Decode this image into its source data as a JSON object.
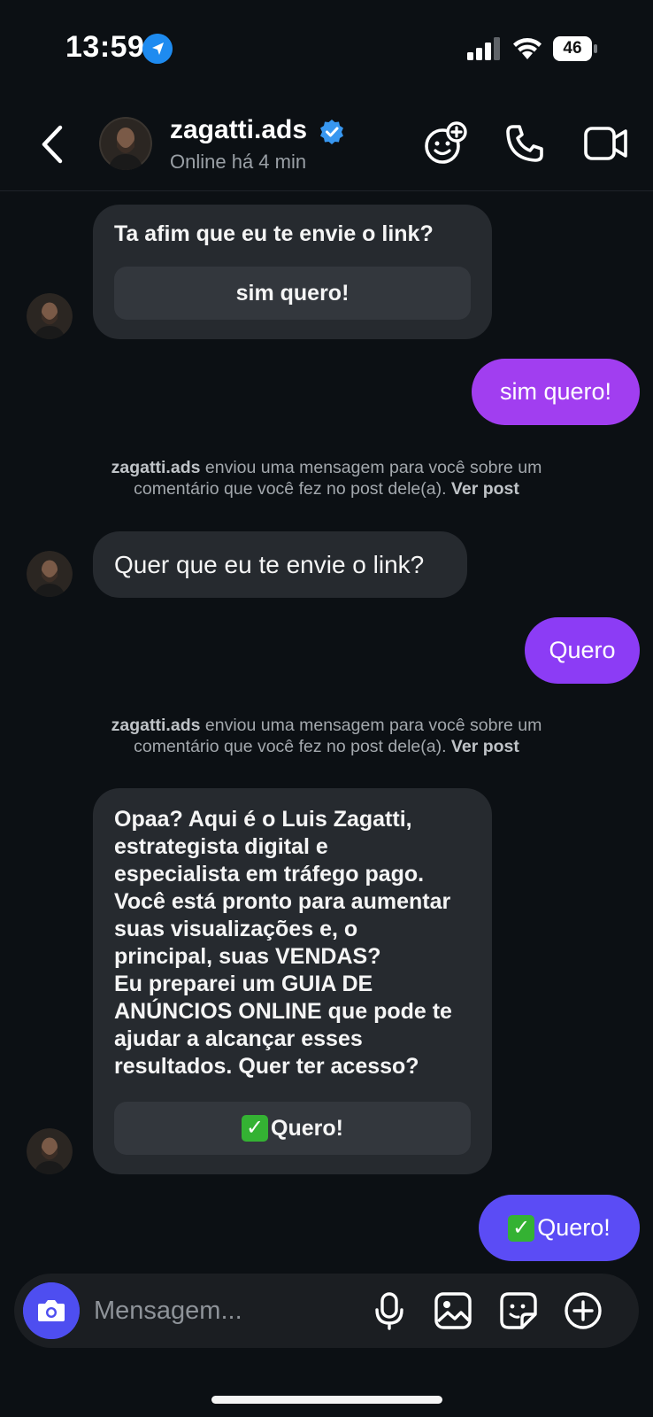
{
  "status_bar": {
    "time": "13:59",
    "battery": "46"
  },
  "header": {
    "username": "zagatti.ads",
    "status": "Online há 4 min"
  },
  "messages": {
    "m1": {
      "text": "Ta afim que eu te envie o link?",
      "button": "sim quero!"
    },
    "m2": {
      "text": "sim quero!"
    },
    "notice1": {
      "sender": "zagatti.ads",
      "text_1": "enviou uma mensagem para você sobre um",
      "text_2": "comentário que você fez no post dele(a).",
      "link": "Ver post"
    },
    "m3": {
      "text": "Quer que eu te envie o link?"
    },
    "m4": {
      "text": "Quero"
    },
    "notice2": {
      "sender": "zagatti.ads",
      "text_1": "enviou uma mensagem para você sobre um",
      "text_2": "comentário que você fez no post dele(a).",
      "link": "Ver post"
    },
    "m5": {
      "lines": [
        "Opaa? Aqui é o Luis Zagatti,",
        "estrategista digital e",
        "especialista em tráfego pago.",
        "Você está pronto para aumentar",
        "suas visualizações e, o",
        "principal, suas VENDAS?",
        "Eu preparei um GUIA DE",
        "ANÚNCIOS ONLINE que pode te",
        "ajudar a alcançar esses",
        "resultados. Quer ter acesso?"
      ],
      "button_emoji": "✓",
      "button": "Quero!"
    },
    "m6": {
      "emoji": "✓",
      "text": "Quero!"
    }
  },
  "composer": {
    "placeholder": "Mensagem..."
  },
  "colors": {
    "background": "#0c1014",
    "incoming": "#262a2f",
    "outgoing_1": "#a13ef0",
    "outgoing_2": "#8c3cf5",
    "outgoing_3": "#5b4cf5",
    "camera": "#4e4ef0",
    "verified": "#3897f0"
  }
}
